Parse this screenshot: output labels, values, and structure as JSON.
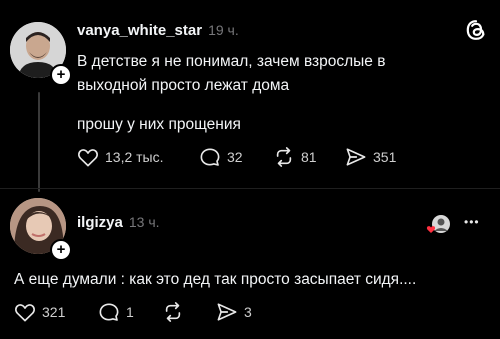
{
  "post": {
    "username": "vanya_white_star",
    "time": "19 ч.",
    "text_line1": "В детстве я не понимал, зачем взрослые в",
    "text_line2": "выходной просто лежат дома",
    "text_line3": "прошу у них прощения",
    "likes": "13,2 тыс.",
    "comments": "32",
    "reposts": "81",
    "shares": "351"
  },
  "reply": {
    "username": "ilgizya",
    "time": "13 ч.",
    "text": "А еще думали : как это дед так просто засыпает сидя....",
    "likes": "321",
    "comments": "1",
    "shares": "3",
    "more": "•••"
  },
  "app": {
    "logo": "threads-icon"
  }
}
